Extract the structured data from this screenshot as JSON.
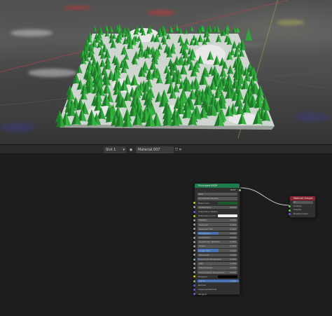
{
  "header": {
    "slot": "Slot 1",
    "material": "Material.007"
  },
  "bsdf_node": {
    "title": "Principled BSDF",
    "output_label": "BSDF",
    "distribution": "GGX",
    "subsurface_method": "Christensen-Burley",
    "base_color_label": "Base Color",
    "base_color_value": "#1c5a2e",
    "rows": [
      {
        "label": "Subsurface",
        "value": "0.000",
        "kind": "bar",
        "fill": 0
      },
      {
        "label": "Subsurface Radius",
        "value": "",
        "kind": "text"
      },
      {
        "label": "Subsurface Color",
        "value": "",
        "kind": "color",
        "color": "#f0f0f0"
      },
      {
        "label": "Metallic",
        "value": "0.000",
        "kind": "bar",
        "fill": 0
      },
      {
        "label": "Specular",
        "value": "0.500",
        "kind": "bar",
        "fill": 0
      },
      {
        "label": "Specular Tint",
        "value": "0.000",
        "kind": "bar",
        "fill": 0
      },
      {
        "label": "Roughness",
        "value": "0.500",
        "kind": "bar",
        "fill": 0.5
      },
      {
        "label": "Anisotropic",
        "value": "0.000",
        "kind": "bar",
        "fill": 0
      },
      {
        "label": "Anisotropic Rotation",
        "value": "0.000",
        "kind": "bar",
        "fill": 0
      },
      {
        "label": "Sheen",
        "value": "0.000",
        "kind": "bar",
        "fill": 0
      },
      {
        "label": "Sheen Tint",
        "value": "0.500",
        "kind": "bar",
        "fill": 0.5
      },
      {
        "label": "Clearcoat",
        "value": "0.000",
        "kind": "bar",
        "fill": 0
      },
      {
        "label": "Clearcoat Roughness",
        "value": "0.030",
        "kind": "bar",
        "fill": 0.03
      },
      {
        "label": "IOR",
        "value": "1.450",
        "kind": "bar",
        "fill": 0
      },
      {
        "label": "Transmission",
        "value": "0.000",
        "kind": "bar",
        "fill": 0
      },
      {
        "label": "Transmission Roughness",
        "value": "0.000",
        "kind": "bar",
        "fill": 0
      },
      {
        "label": "Emission",
        "value": "",
        "kind": "color",
        "color": "#050505"
      },
      {
        "label": "Alpha",
        "value": "1.000",
        "kind": "bar",
        "fill": 1
      },
      {
        "label": "Normal",
        "value": "",
        "kind": "text"
      },
      {
        "label": "Clearcoat Normal",
        "value": "",
        "kind": "text"
      },
      {
        "label": "Tangent",
        "value": "",
        "kind": "text"
      }
    ]
  },
  "output_node": {
    "title": "Material Output",
    "target": "All",
    "inputs": [
      "Surface",
      "Volume",
      "Displacement"
    ]
  },
  "colors": {
    "tree_green": "#2fa63a",
    "tree_dark": "#1f7a2a",
    "snow": "#e8e8e8",
    "bsdf_header": "#1e7b4c",
    "output_header": "#8a2431",
    "link": "#c9c9c9"
  }
}
